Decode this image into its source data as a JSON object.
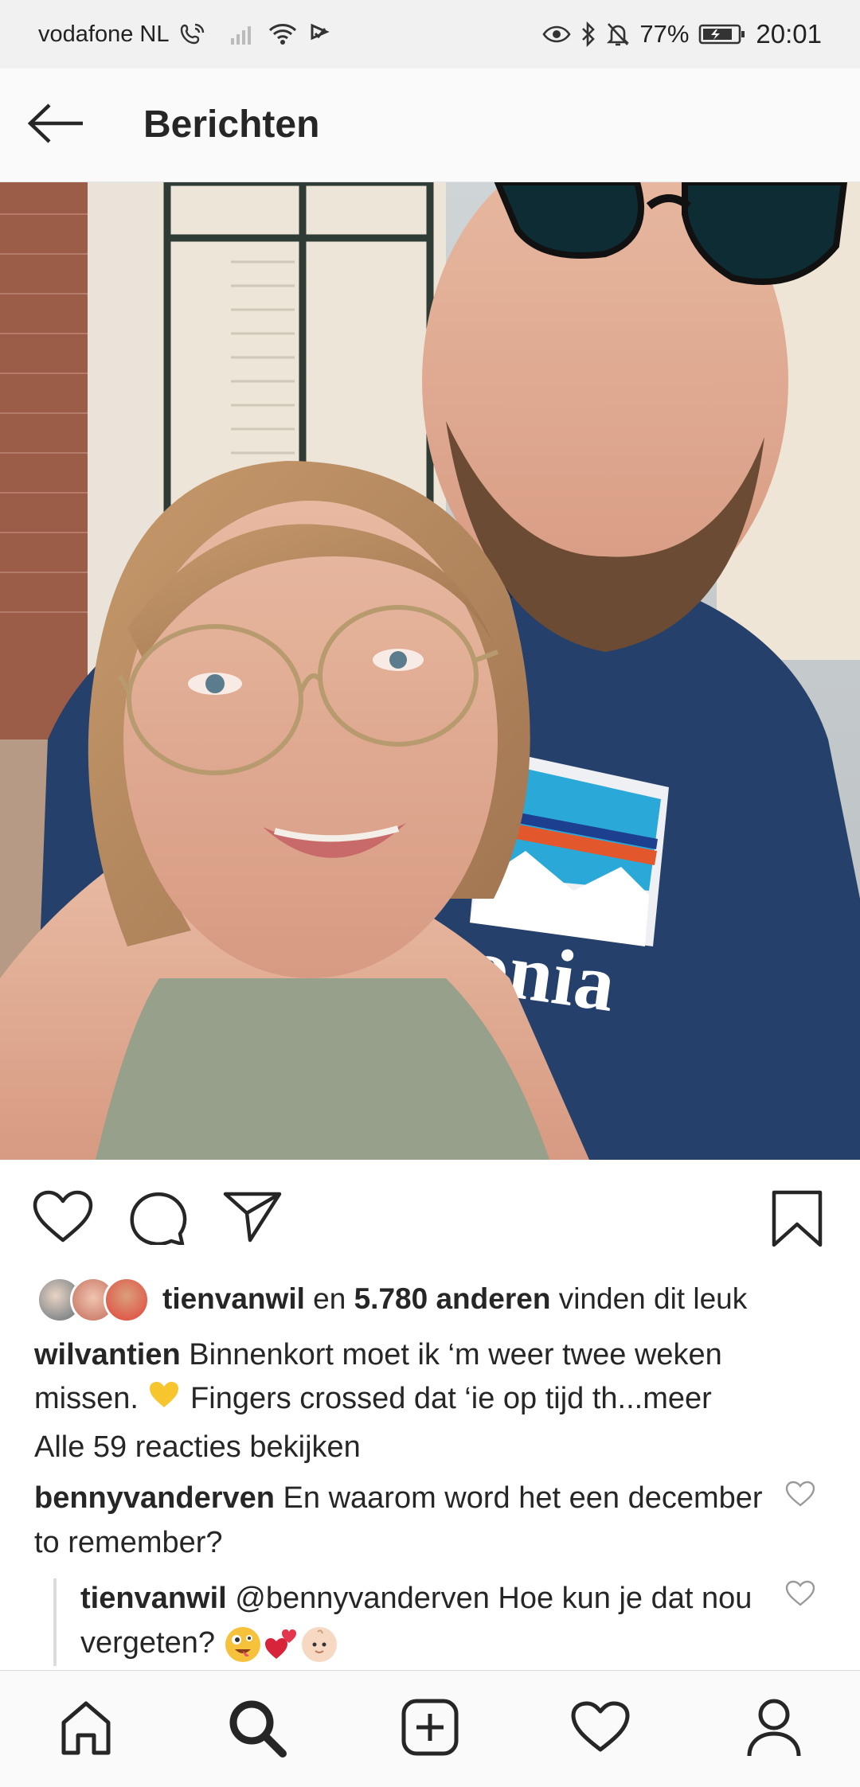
{
  "status_bar": {
    "carrier": "vodafone NL",
    "battery_percent": "77%",
    "time": "20:01",
    "icons": [
      "wifi-call-icon",
      "signal-icon",
      "wifi-icon",
      "cast-icon",
      "eye-icon",
      "bluetooth-icon",
      "mute-bell-icon",
      "battery-icon"
    ]
  },
  "header": {
    "title": "Berichten",
    "back_icon": "arrow-left-icon"
  },
  "post": {
    "likes": {
      "user": "tienvanwil",
      "connector": " en ",
      "count": "5.780 anderen",
      "suffix": " vinden dit leuk"
    },
    "caption": {
      "user": "wilvantien",
      "text_1": " Binnenkort moet ik ‘m weer twee weken missen. ",
      "emoji": "yellow-heart",
      "text_2": " Fingers crossed dat ‘ie op tijd th...",
      "more": "meer"
    },
    "view_all_comments": "Alle 59 reacties bekijken",
    "comments": [
      {
        "user": "bennyvanderven",
        "text": " En waarom word het een december to remember?"
      },
      {
        "user": "tienvanwil",
        "text": " @bennyvanderven Hoe kun je dat nou vergeten? ",
        "emojis": [
          "zany-face",
          "two-hearts",
          "baby"
        ]
      }
    ]
  },
  "colors": {
    "text": "#262626",
    "status_bg": "#f1f1f1",
    "nav_bg": "#fafafa",
    "divider": "#dbdbdb"
  },
  "bottom_nav": [
    "home-icon",
    "search-icon",
    "add-post-icon",
    "activity-heart-icon",
    "profile-icon"
  ]
}
